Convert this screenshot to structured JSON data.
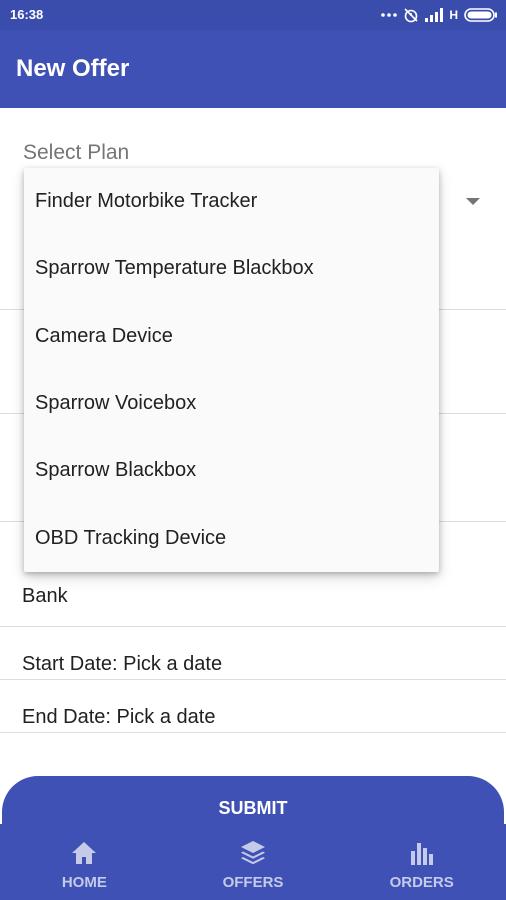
{
  "status_bar": {
    "time": "16:38",
    "network_type": "H",
    "icons": [
      "dots-icon",
      "alarm-off-icon",
      "signal-icon",
      "battery-icon"
    ]
  },
  "app_bar": {
    "title": "New Offer"
  },
  "form": {
    "select_plan_label": "Select Plan",
    "bank_label": "Bank",
    "start_date": "Start Date: Pick a date",
    "end_date": "End Date: Pick a date"
  },
  "plan_menu": {
    "options": [
      "Finder Motorbike Tracker",
      "Sparrow Temperature Blackbox",
      "Camera Device",
      "Sparrow Voicebox",
      "Sparrow Blackbox",
      "OBD Tracking Device"
    ]
  },
  "submit_label": "SUBMIT",
  "bottom_nav": {
    "items": [
      {
        "label": "HOME",
        "icon": "home-icon"
      },
      {
        "label": "OFFERS",
        "icon": "layers-icon"
      },
      {
        "label": "ORDERS",
        "icon": "bar-chart-icon"
      }
    ]
  },
  "colors": {
    "primary": "#3f51b5",
    "status_bar": "#3a4dac",
    "nav_label": "#c5cae9"
  }
}
